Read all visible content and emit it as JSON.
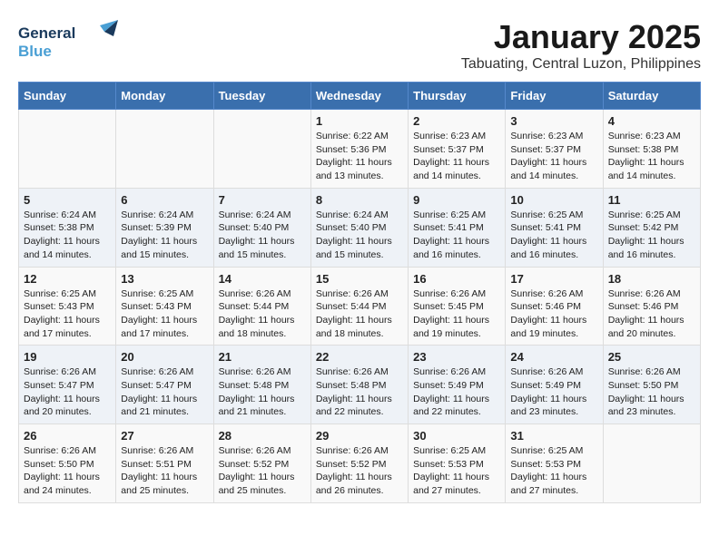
{
  "logo": {
    "line1": "General",
    "line2": "Blue"
  },
  "title": "January 2025",
  "location": "Tabuating, Central Luzon, Philippines",
  "weekdays": [
    "Sunday",
    "Monday",
    "Tuesday",
    "Wednesday",
    "Thursday",
    "Friday",
    "Saturday"
  ],
  "weeks": [
    [
      {
        "day": "",
        "info": ""
      },
      {
        "day": "",
        "info": ""
      },
      {
        "day": "",
        "info": ""
      },
      {
        "day": "1",
        "info": "Sunrise: 6:22 AM\nSunset: 5:36 PM\nDaylight: 11 hours\nand 13 minutes."
      },
      {
        "day": "2",
        "info": "Sunrise: 6:23 AM\nSunset: 5:37 PM\nDaylight: 11 hours\nand 14 minutes."
      },
      {
        "day": "3",
        "info": "Sunrise: 6:23 AM\nSunset: 5:37 PM\nDaylight: 11 hours\nand 14 minutes."
      },
      {
        "day": "4",
        "info": "Sunrise: 6:23 AM\nSunset: 5:38 PM\nDaylight: 11 hours\nand 14 minutes."
      }
    ],
    [
      {
        "day": "5",
        "info": "Sunrise: 6:24 AM\nSunset: 5:38 PM\nDaylight: 11 hours\nand 14 minutes."
      },
      {
        "day": "6",
        "info": "Sunrise: 6:24 AM\nSunset: 5:39 PM\nDaylight: 11 hours\nand 15 minutes."
      },
      {
        "day": "7",
        "info": "Sunrise: 6:24 AM\nSunset: 5:40 PM\nDaylight: 11 hours\nand 15 minutes."
      },
      {
        "day": "8",
        "info": "Sunrise: 6:24 AM\nSunset: 5:40 PM\nDaylight: 11 hours\nand 15 minutes."
      },
      {
        "day": "9",
        "info": "Sunrise: 6:25 AM\nSunset: 5:41 PM\nDaylight: 11 hours\nand 16 minutes."
      },
      {
        "day": "10",
        "info": "Sunrise: 6:25 AM\nSunset: 5:41 PM\nDaylight: 11 hours\nand 16 minutes."
      },
      {
        "day": "11",
        "info": "Sunrise: 6:25 AM\nSunset: 5:42 PM\nDaylight: 11 hours\nand 16 minutes."
      }
    ],
    [
      {
        "day": "12",
        "info": "Sunrise: 6:25 AM\nSunset: 5:43 PM\nDaylight: 11 hours\nand 17 minutes."
      },
      {
        "day": "13",
        "info": "Sunrise: 6:25 AM\nSunset: 5:43 PM\nDaylight: 11 hours\nand 17 minutes."
      },
      {
        "day": "14",
        "info": "Sunrise: 6:26 AM\nSunset: 5:44 PM\nDaylight: 11 hours\nand 18 minutes."
      },
      {
        "day": "15",
        "info": "Sunrise: 6:26 AM\nSunset: 5:44 PM\nDaylight: 11 hours\nand 18 minutes."
      },
      {
        "day": "16",
        "info": "Sunrise: 6:26 AM\nSunset: 5:45 PM\nDaylight: 11 hours\nand 19 minutes."
      },
      {
        "day": "17",
        "info": "Sunrise: 6:26 AM\nSunset: 5:46 PM\nDaylight: 11 hours\nand 19 minutes."
      },
      {
        "day": "18",
        "info": "Sunrise: 6:26 AM\nSunset: 5:46 PM\nDaylight: 11 hours\nand 20 minutes."
      }
    ],
    [
      {
        "day": "19",
        "info": "Sunrise: 6:26 AM\nSunset: 5:47 PM\nDaylight: 11 hours\nand 20 minutes."
      },
      {
        "day": "20",
        "info": "Sunrise: 6:26 AM\nSunset: 5:47 PM\nDaylight: 11 hours\nand 21 minutes."
      },
      {
        "day": "21",
        "info": "Sunrise: 6:26 AM\nSunset: 5:48 PM\nDaylight: 11 hours\nand 21 minutes."
      },
      {
        "day": "22",
        "info": "Sunrise: 6:26 AM\nSunset: 5:48 PM\nDaylight: 11 hours\nand 22 minutes."
      },
      {
        "day": "23",
        "info": "Sunrise: 6:26 AM\nSunset: 5:49 PM\nDaylight: 11 hours\nand 22 minutes."
      },
      {
        "day": "24",
        "info": "Sunrise: 6:26 AM\nSunset: 5:49 PM\nDaylight: 11 hours\nand 23 minutes."
      },
      {
        "day": "25",
        "info": "Sunrise: 6:26 AM\nSunset: 5:50 PM\nDaylight: 11 hours\nand 23 minutes."
      }
    ],
    [
      {
        "day": "26",
        "info": "Sunrise: 6:26 AM\nSunset: 5:50 PM\nDaylight: 11 hours\nand 24 minutes."
      },
      {
        "day": "27",
        "info": "Sunrise: 6:26 AM\nSunset: 5:51 PM\nDaylight: 11 hours\nand 25 minutes."
      },
      {
        "day": "28",
        "info": "Sunrise: 6:26 AM\nSunset: 5:52 PM\nDaylight: 11 hours\nand 25 minutes."
      },
      {
        "day": "29",
        "info": "Sunrise: 6:26 AM\nSunset: 5:52 PM\nDaylight: 11 hours\nand 26 minutes."
      },
      {
        "day": "30",
        "info": "Sunrise: 6:25 AM\nSunset: 5:53 PM\nDaylight: 11 hours\nand 27 minutes."
      },
      {
        "day": "31",
        "info": "Sunrise: 6:25 AM\nSunset: 5:53 PM\nDaylight: 11 hours\nand 27 minutes."
      },
      {
        "day": "",
        "info": ""
      }
    ]
  ]
}
